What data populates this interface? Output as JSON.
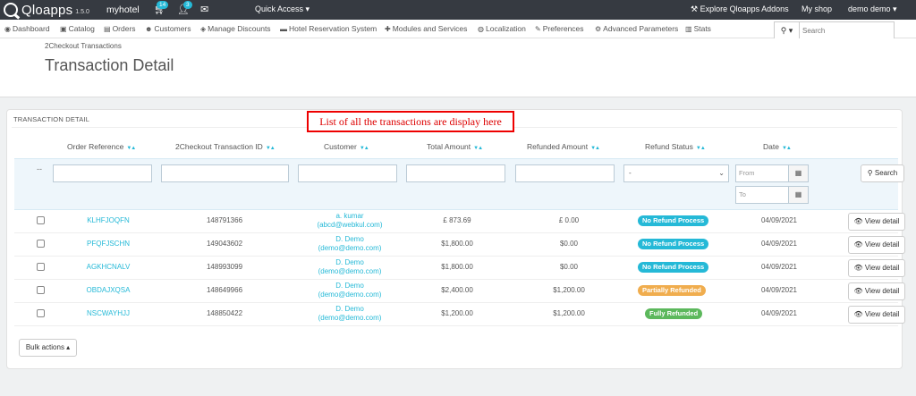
{
  "topbar": {
    "logo_text": "Qloapps",
    "version": "1.5.0",
    "hotel_name": "myhotel",
    "cart_badge": "14",
    "user_badge": "3",
    "quick_access": "Quick Access ▾",
    "explore": "Explore Qloapps Addons",
    "my_shop": "My shop",
    "user": "demo demo ▾"
  },
  "menu": [
    {
      "icon": "dashboard-icon",
      "label": "Dashboard"
    },
    {
      "icon": "catalog-icon",
      "label": "Catalog"
    },
    {
      "icon": "orders-icon",
      "label": "Orders"
    },
    {
      "icon": "customers-icon",
      "label": "Customers"
    },
    {
      "icon": "discounts-icon",
      "label": "Manage Discounts"
    },
    {
      "icon": "hotel-icon",
      "label": "Hotel Reservation System"
    },
    {
      "icon": "modules-icon",
      "label": "Modules and Services"
    },
    {
      "icon": "localization-icon",
      "label": "Localization"
    },
    {
      "icon": "preferences-icon",
      "label": "Preferences"
    },
    {
      "icon": "advanced-icon",
      "label": "Advanced Parameters"
    },
    {
      "icon": "stats-icon",
      "label": "Stats"
    }
  ],
  "search": {
    "placeholder": "Search"
  },
  "header": {
    "breadcrumb": "2Checkout Transactions",
    "title": "Transaction Detail"
  },
  "panel": {
    "title": "TRANSACTION DETAIL",
    "callout": "List of all the transactions are display here",
    "columns": [
      "Order Reference",
      "2Checkout Transaction ID",
      "Customer",
      "Total Amount",
      "Refunded Amount",
      "Refund Status",
      "Date"
    ],
    "filter_dash": "--",
    "filter_select": "-",
    "date_from": "From",
    "date_to": "To",
    "search_btn": "Search",
    "view_btn": "View detail",
    "bulk_actions": "Bulk actions ▴"
  },
  "rows": [
    {
      "ref": "KLHFJOQFN",
      "txn": "148791366",
      "cust_name": "a. kumar",
      "cust_email": "(abcd@webkul.com)",
      "total": "£ 873.69",
      "refunded": "£ 0.00",
      "status": "No Refund Process",
      "status_color": "#25b9d7",
      "date": "04/09/2021"
    },
    {
      "ref": "PFQFJSCHN",
      "txn": "149043602",
      "cust_name": "D. Demo",
      "cust_email": "(demo@demo.com)",
      "total": "$1,800.00",
      "refunded": "$0.00",
      "status": "No Refund Process",
      "status_color": "#25b9d7",
      "date": "04/09/2021"
    },
    {
      "ref": "AGKHCNALV",
      "txn": "148993099",
      "cust_name": "D. Demo",
      "cust_email": "(demo@demo.com)",
      "total": "$1,800.00",
      "refunded": "$0.00",
      "status": "No Refund Process",
      "status_color": "#25b9d7",
      "date": "04/09/2021"
    },
    {
      "ref": "OBDAJXQSA",
      "txn": "148649966",
      "cust_name": "D. Demo",
      "cust_email": "(demo@demo.com)",
      "total": "$2,400.00",
      "refunded": "$1,200.00",
      "status": "Partially Refunded",
      "status_color": "#f0ad4e",
      "date": "04/09/2021"
    },
    {
      "ref": "NSCWAYHJJ",
      "txn": "148850422",
      "cust_name": "D. Demo",
      "cust_email": "(demo@demo.com)",
      "total": "$1,200.00",
      "refunded": "$1,200.00",
      "status": "Fully Refunded",
      "status_color": "#5cb85c",
      "date": "04/09/2021"
    }
  ]
}
